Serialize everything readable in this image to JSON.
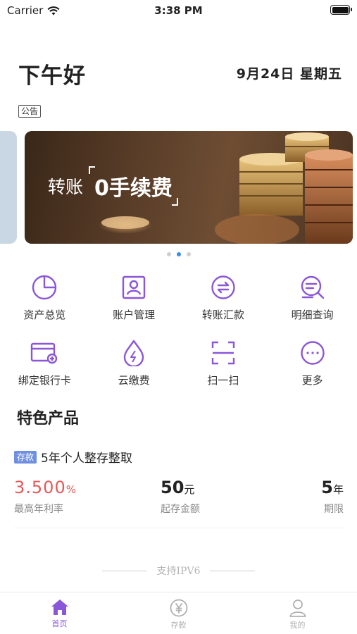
{
  "status_bar": {
    "carrier": "Carrier",
    "time": "3:38 PM"
  },
  "header": {
    "greeting": "下午好",
    "date": "9月24日 星期五",
    "notice_label": "公告"
  },
  "banner": {
    "text_prefix": "转账",
    "text_highlight": "0手续费",
    "dot_count": 3,
    "active_dot": 1
  },
  "accent_color": "#8a57d8",
  "features": [
    {
      "label": "资产总览",
      "icon": "pie-chart-icon"
    },
    {
      "label": "账户管理",
      "icon": "account-id-icon"
    },
    {
      "label": "转账汇款",
      "icon": "transfer-icon"
    },
    {
      "label": "明细查询",
      "icon": "detail-search-icon"
    },
    {
      "label": "绑定银行卡",
      "icon": "bind-card-icon"
    },
    {
      "label": "云缴费",
      "icon": "water-drop-icon"
    },
    {
      "label": "扫一扫",
      "icon": "scan-icon"
    },
    {
      "label": "更多",
      "icon": "more-icon"
    }
  ],
  "section": {
    "title": "特色产品"
  },
  "product": {
    "tag": "存款",
    "name": "5年个人整存整取",
    "rate_value": "3.500",
    "rate_unit": "%",
    "rate_label": "最高年利率",
    "min_value": "50",
    "min_unit": "元",
    "min_label": "起存金额",
    "term_value": "5",
    "term_unit": "年",
    "term_label": "期限"
  },
  "footer_note": "支持IPV6",
  "tabbar": [
    {
      "label": "首页",
      "icon": "home-icon",
      "active": true
    },
    {
      "label": "存款",
      "icon": "yen-icon",
      "active": false
    },
    {
      "label": "我的",
      "icon": "user-icon",
      "active": false
    }
  ]
}
